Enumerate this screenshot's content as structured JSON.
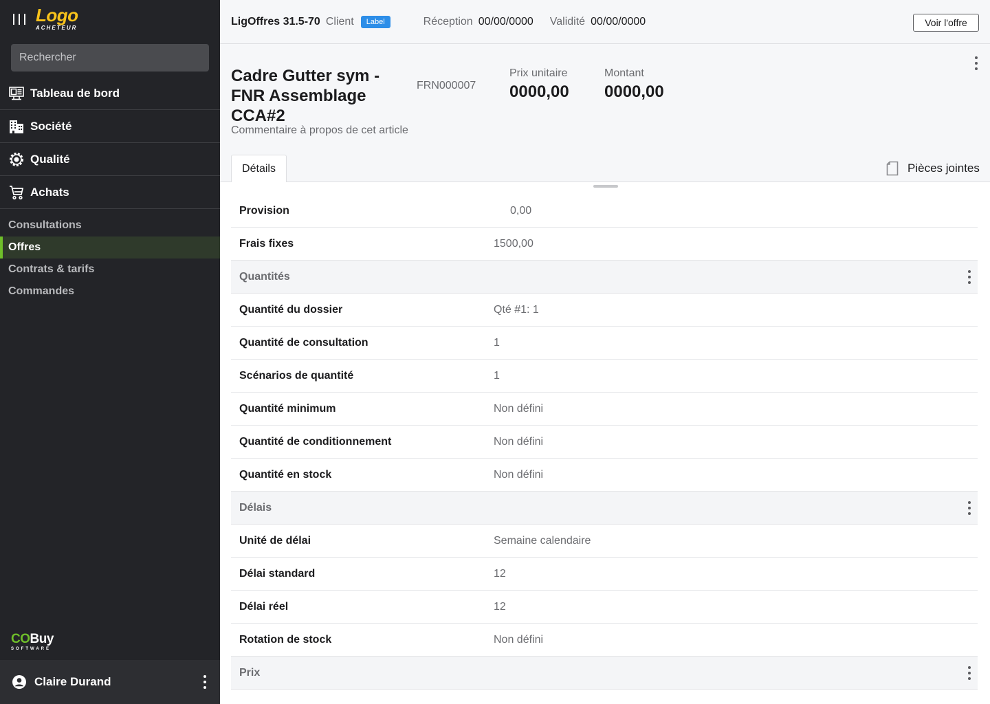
{
  "sidebar": {
    "logo_main": "Logo",
    "logo_sub": "ACHETEUR",
    "search_placeholder": "Rechercher",
    "nav": [
      {
        "label": "Tableau de bord",
        "icon": "dashboard-icon"
      },
      {
        "label": "Société",
        "icon": "building-icon"
      },
      {
        "label": "Qualité",
        "icon": "quality-gear-icon"
      },
      {
        "label": "Achats",
        "icon": "cart-icon"
      }
    ],
    "sub": [
      {
        "label": "Consultations",
        "active": false
      },
      {
        "label": "Offres",
        "active": true
      },
      {
        "label": "Contrats & tarifs",
        "active": false
      },
      {
        "label": "Commandes",
        "active": false
      }
    ],
    "brand_co": "CO",
    "brand_buy": "Buy",
    "brand_sub": "SOFTWARE",
    "user_name": "Claire Durand"
  },
  "header": {
    "reference": "LigOffres 31.5-70",
    "client_label": "Client",
    "badge": "Label",
    "reception_label": "Réception",
    "reception_value": "00/00/0000",
    "validite_label": "Validité",
    "validite_value": "00/00/0000",
    "voir_button": "Voir l'offre"
  },
  "article": {
    "title": "Cadre Gutter sym - FNR Assemblage CCA#2",
    "code": "FRN000007",
    "prix_unitaire_label": "Prix unitaire",
    "prix_unitaire_value": "0000,00",
    "montant_label": "Montant",
    "montant_value": "0000,00",
    "comment": "Commentaire à propos de cet article"
  },
  "tabs": {
    "details": "Détails",
    "attachments": "Pièces jointes"
  },
  "rows": [
    {
      "type": "field",
      "label": "Provision",
      "value": "0,00"
    },
    {
      "type": "field",
      "label": "Frais fixes",
      "value": "1500,00"
    },
    {
      "type": "section",
      "label": "Quantités"
    },
    {
      "type": "field",
      "label": "Quantité du dossier",
      "value": "Qté #1: 1"
    },
    {
      "type": "field",
      "label": "Quantité de consultation",
      "value": "1"
    },
    {
      "type": "field",
      "label": "Scénarios de quantité",
      "value": "1"
    },
    {
      "type": "field",
      "label": "Quantité minimum",
      "value": "Non défini"
    },
    {
      "type": "field",
      "label": "Quantité de conditionnement",
      "value": "Non défini"
    },
    {
      "type": "field",
      "label": "Quantité en stock",
      "value": "Non défini"
    },
    {
      "type": "section",
      "label": "Délais"
    },
    {
      "type": "field",
      "label": "Unité de délai",
      "value": "Semaine calendaire"
    },
    {
      "type": "field",
      "label": "Délai standard",
      "value": "12"
    },
    {
      "type": "field",
      "label": "Délai réel",
      "value": "12"
    },
    {
      "type": "field",
      "label": "Rotation de stock",
      "value": "Non défini"
    },
    {
      "type": "section",
      "label": "Prix"
    }
  ],
  "colors": {
    "sidebar_bg": "#232428",
    "logo": "#f7c21b",
    "active_accent": "#6fbf2a",
    "badge": "#2d8ee8"
  }
}
